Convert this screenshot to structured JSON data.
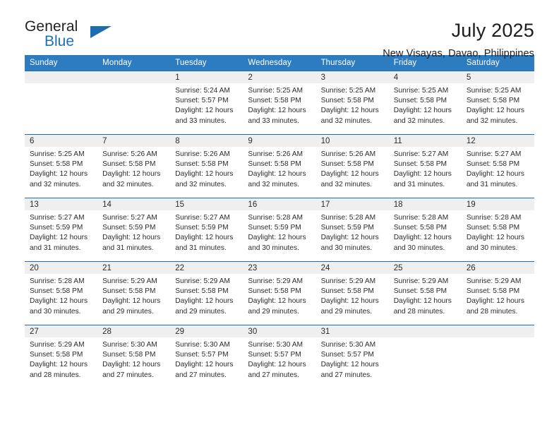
{
  "brand": {
    "name_part1": "General",
    "name_part2": "Blue",
    "logo_icon": "triangle-logo-icon"
  },
  "header": {
    "title": "July 2025",
    "subtitle": "New Visayas, Davao, Philippines"
  },
  "colors": {
    "header_blue": "#2d7cc0",
    "row_border_blue": "#1f6cab",
    "daynum_band": "#efefef",
    "brand_blue": "#1b70b8",
    "text": "#2b2b2b"
  },
  "calendar": {
    "weekday_headers": [
      "Sunday",
      "Monday",
      "Tuesday",
      "Wednesday",
      "Thursday",
      "Friday",
      "Saturday"
    ],
    "weeks": [
      [
        {
          "day": "",
          "empty": true,
          "sunrise": "",
          "sunset": "",
          "daylight_line1": "",
          "daylight_line2": ""
        },
        {
          "day": "",
          "empty": true,
          "sunrise": "",
          "sunset": "",
          "daylight_line1": "",
          "daylight_line2": ""
        },
        {
          "day": "1",
          "empty": false,
          "sunrise": "Sunrise: 5:24 AM",
          "sunset": "Sunset: 5:57 PM",
          "daylight_line1": "Daylight: 12 hours",
          "daylight_line2": "and 33 minutes."
        },
        {
          "day": "2",
          "empty": false,
          "sunrise": "Sunrise: 5:25 AM",
          "sunset": "Sunset: 5:58 PM",
          "daylight_line1": "Daylight: 12 hours",
          "daylight_line2": "and 33 minutes."
        },
        {
          "day": "3",
          "empty": false,
          "sunrise": "Sunrise: 5:25 AM",
          "sunset": "Sunset: 5:58 PM",
          "daylight_line1": "Daylight: 12 hours",
          "daylight_line2": "and 32 minutes."
        },
        {
          "day": "4",
          "empty": false,
          "sunrise": "Sunrise: 5:25 AM",
          "sunset": "Sunset: 5:58 PM",
          "daylight_line1": "Daylight: 12 hours",
          "daylight_line2": "and 32 minutes."
        },
        {
          "day": "5",
          "empty": false,
          "sunrise": "Sunrise: 5:25 AM",
          "sunset": "Sunset: 5:58 PM",
          "daylight_line1": "Daylight: 12 hours",
          "daylight_line2": "and 32 minutes."
        }
      ],
      [
        {
          "day": "6",
          "empty": false,
          "sunrise": "Sunrise: 5:25 AM",
          "sunset": "Sunset: 5:58 PM",
          "daylight_line1": "Daylight: 12 hours",
          "daylight_line2": "and 32 minutes."
        },
        {
          "day": "7",
          "empty": false,
          "sunrise": "Sunrise: 5:26 AM",
          "sunset": "Sunset: 5:58 PM",
          "daylight_line1": "Daylight: 12 hours",
          "daylight_line2": "and 32 minutes."
        },
        {
          "day": "8",
          "empty": false,
          "sunrise": "Sunrise: 5:26 AM",
          "sunset": "Sunset: 5:58 PM",
          "daylight_line1": "Daylight: 12 hours",
          "daylight_line2": "and 32 minutes."
        },
        {
          "day": "9",
          "empty": false,
          "sunrise": "Sunrise: 5:26 AM",
          "sunset": "Sunset: 5:58 PM",
          "daylight_line1": "Daylight: 12 hours",
          "daylight_line2": "and 32 minutes."
        },
        {
          "day": "10",
          "empty": false,
          "sunrise": "Sunrise: 5:26 AM",
          "sunset": "Sunset: 5:58 PM",
          "daylight_line1": "Daylight: 12 hours",
          "daylight_line2": "and 32 minutes."
        },
        {
          "day": "11",
          "empty": false,
          "sunrise": "Sunrise: 5:27 AM",
          "sunset": "Sunset: 5:58 PM",
          "daylight_line1": "Daylight: 12 hours",
          "daylight_line2": "and 31 minutes."
        },
        {
          "day": "12",
          "empty": false,
          "sunrise": "Sunrise: 5:27 AM",
          "sunset": "Sunset: 5:58 PM",
          "daylight_line1": "Daylight: 12 hours",
          "daylight_line2": "and 31 minutes."
        }
      ],
      [
        {
          "day": "13",
          "empty": false,
          "sunrise": "Sunrise: 5:27 AM",
          "sunset": "Sunset: 5:59 PM",
          "daylight_line1": "Daylight: 12 hours",
          "daylight_line2": "and 31 minutes."
        },
        {
          "day": "14",
          "empty": false,
          "sunrise": "Sunrise: 5:27 AM",
          "sunset": "Sunset: 5:59 PM",
          "daylight_line1": "Daylight: 12 hours",
          "daylight_line2": "and 31 minutes."
        },
        {
          "day": "15",
          "empty": false,
          "sunrise": "Sunrise: 5:27 AM",
          "sunset": "Sunset: 5:59 PM",
          "daylight_line1": "Daylight: 12 hours",
          "daylight_line2": "and 31 minutes."
        },
        {
          "day": "16",
          "empty": false,
          "sunrise": "Sunrise: 5:28 AM",
          "sunset": "Sunset: 5:59 PM",
          "daylight_line1": "Daylight: 12 hours",
          "daylight_line2": "and 30 minutes."
        },
        {
          "day": "17",
          "empty": false,
          "sunrise": "Sunrise: 5:28 AM",
          "sunset": "Sunset: 5:59 PM",
          "daylight_line1": "Daylight: 12 hours",
          "daylight_line2": "and 30 minutes."
        },
        {
          "day": "18",
          "empty": false,
          "sunrise": "Sunrise: 5:28 AM",
          "sunset": "Sunset: 5:58 PM",
          "daylight_line1": "Daylight: 12 hours",
          "daylight_line2": "and 30 minutes."
        },
        {
          "day": "19",
          "empty": false,
          "sunrise": "Sunrise: 5:28 AM",
          "sunset": "Sunset: 5:58 PM",
          "daylight_line1": "Daylight: 12 hours",
          "daylight_line2": "and 30 minutes."
        }
      ],
      [
        {
          "day": "20",
          "empty": false,
          "sunrise": "Sunrise: 5:28 AM",
          "sunset": "Sunset: 5:58 PM",
          "daylight_line1": "Daylight: 12 hours",
          "daylight_line2": "and 30 minutes."
        },
        {
          "day": "21",
          "empty": false,
          "sunrise": "Sunrise: 5:29 AM",
          "sunset": "Sunset: 5:58 PM",
          "daylight_line1": "Daylight: 12 hours",
          "daylight_line2": "and 29 minutes."
        },
        {
          "day": "22",
          "empty": false,
          "sunrise": "Sunrise: 5:29 AM",
          "sunset": "Sunset: 5:58 PM",
          "daylight_line1": "Daylight: 12 hours",
          "daylight_line2": "and 29 minutes."
        },
        {
          "day": "23",
          "empty": false,
          "sunrise": "Sunrise: 5:29 AM",
          "sunset": "Sunset: 5:58 PM",
          "daylight_line1": "Daylight: 12 hours",
          "daylight_line2": "and 29 minutes."
        },
        {
          "day": "24",
          "empty": false,
          "sunrise": "Sunrise: 5:29 AM",
          "sunset": "Sunset: 5:58 PM",
          "daylight_line1": "Daylight: 12 hours",
          "daylight_line2": "and 29 minutes."
        },
        {
          "day": "25",
          "empty": false,
          "sunrise": "Sunrise: 5:29 AM",
          "sunset": "Sunset: 5:58 PM",
          "daylight_line1": "Daylight: 12 hours",
          "daylight_line2": "and 28 minutes."
        },
        {
          "day": "26",
          "empty": false,
          "sunrise": "Sunrise: 5:29 AM",
          "sunset": "Sunset: 5:58 PM",
          "daylight_line1": "Daylight: 12 hours",
          "daylight_line2": "and 28 minutes."
        }
      ],
      [
        {
          "day": "27",
          "empty": false,
          "sunrise": "Sunrise: 5:29 AM",
          "sunset": "Sunset: 5:58 PM",
          "daylight_line1": "Daylight: 12 hours",
          "daylight_line2": "and 28 minutes."
        },
        {
          "day": "28",
          "empty": false,
          "sunrise": "Sunrise: 5:30 AM",
          "sunset": "Sunset: 5:58 PM",
          "daylight_line1": "Daylight: 12 hours",
          "daylight_line2": "and 27 minutes."
        },
        {
          "day": "29",
          "empty": false,
          "sunrise": "Sunrise: 5:30 AM",
          "sunset": "Sunset: 5:57 PM",
          "daylight_line1": "Daylight: 12 hours",
          "daylight_line2": "and 27 minutes."
        },
        {
          "day": "30",
          "empty": false,
          "sunrise": "Sunrise: 5:30 AM",
          "sunset": "Sunset: 5:57 PM",
          "daylight_line1": "Daylight: 12 hours",
          "daylight_line2": "and 27 minutes."
        },
        {
          "day": "31",
          "empty": false,
          "sunrise": "Sunrise: 5:30 AM",
          "sunset": "Sunset: 5:57 PM",
          "daylight_line1": "Daylight: 12 hours",
          "daylight_line2": "and 27 minutes."
        },
        {
          "day": "",
          "empty": true,
          "sunrise": "",
          "sunset": "",
          "daylight_line1": "",
          "daylight_line2": ""
        },
        {
          "day": "",
          "empty": true,
          "sunrise": "",
          "sunset": "",
          "daylight_line1": "",
          "daylight_line2": ""
        }
      ]
    ]
  }
}
